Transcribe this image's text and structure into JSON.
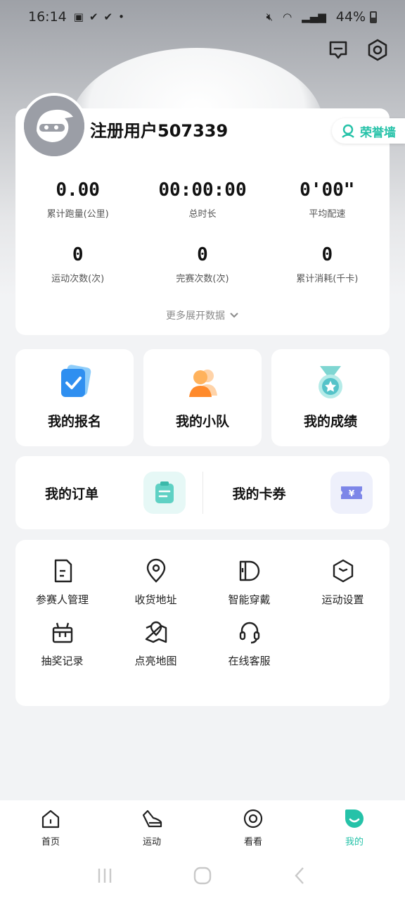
{
  "status_bar": {
    "time": "16:14",
    "battery": "44%"
  },
  "profile": {
    "username": "注册用户507339",
    "honor_label": "荣誉墙",
    "stats": [
      {
        "value": "0.00",
        "label": "累计跑量(公里)"
      },
      {
        "value": "00:00:00",
        "label": "总时长"
      },
      {
        "value": "0'00\"",
        "label": "平均配速"
      },
      {
        "value": "0",
        "label": "运动次数(次)"
      },
      {
        "value": "0",
        "label": "完赛次数(次)"
      },
      {
        "value": "0",
        "label": "累计消耗(千卡)"
      }
    ],
    "expand_label": "更多展开数据"
  },
  "tiles": [
    {
      "label": "我的报名",
      "icon": "registration-icon"
    },
    {
      "label": "我的小队",
      "icon": "team-icon"
    },
    {
      "label": "我的成绩",
      "icon": "medal-icon"
    }
  ],
  "orders": {
    "orders_label": "我的订单",
    "coupons_label": "我的卡券"
  },
  "services": [
    {
      "label": "参赛人管理",
      "icon": "document-icon"
    },
    {
      "label": "收货地址",
      "icon": "location-pin-icon"
    },
    {
      "label": "智能穿戴",
      "icon": "wearable-icon"
    },
    {
      "label": "运动设置",
      "icon": "hexagon-settings-icon"
    },
    {
      "label": "抽奖记录",
      "icon": "gift-icon"
    },
    {
      "label": "点亮地图",
      "icon": "map-icon"
    },
    {
      "label": "在线客服",
      "icon": "headset-icon"
    }
  ],
  "tabbar": [
    {
      "label": "首页",
      "icon": "home-icon"
    },
    {
      "label": "运动",
      "icon": "shoe-icon"
    },
    {
      "label": "看看",
      "icon": "eye-icon"
    },
    {
      "label": "我的",
      "icon": "me-icon",
      "active": true
    }
  ],
  "colors": {
    "accent": "#25c2a8",
    "background": "#f2f3f5"
  }
}
